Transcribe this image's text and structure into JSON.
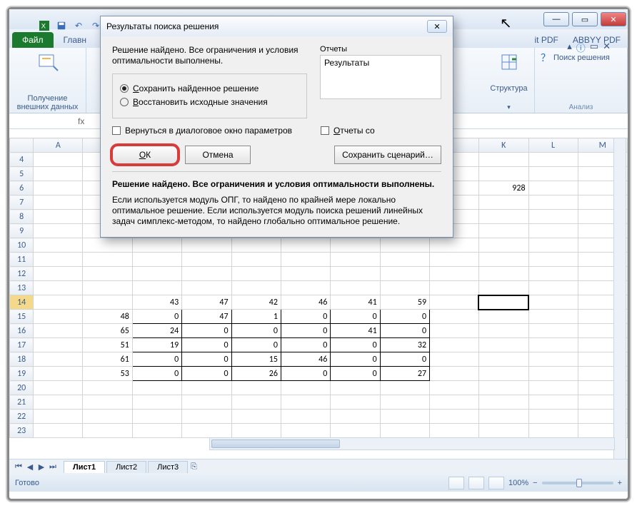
{
  "window": {
    "app_icon": "excel-icon"
  },
  "qat": {
    "save": "save-icon",
    "undo": "undo-icon",
    "redo": "redo-icon"
  },
  "ribbon": {
    "file": "Файл",
    "tabs": [
      "Главн"
    ],
    "right_tabs": [
      "it PDF",
      "ABBYY PDF"
    ],
    "group_getdata_label": "Получение\nвнешних данных",
    "group_struct_label": "Структура",
    "poisk": "Поиск решения",
    "analysis_group": "Анализ"
  },
  "help": {
    "q": "?"
  },
  "columns": [
    "A",
    "",
    "",
    "",
    "",
    "",
    "",
    "",
    "",
    "K",
    "L",
    "M"
  ],
  "first_row": 4,
  "rows": [
    4,
    5,
    6,
    7,
    8,
    9,
    10,
    11,
    12,
    13,
    14,
    15,
    16,
    17,
    18,
    19,
    20,
    21,
    22,
    23
  ],
  "row14_hl": 14,
  "k6": "928",
  "table": {
    "headers": [
      "",
      "43",
      "47",
      "42",
      "46",
      "41",
      "59"
    ],
    "rows": [
      [
        "48",
        "0",
        "47",
        "1",
        "0",
        "0",
        "0"
      ],
      [
        "65",
        "24",
        "0",
        "0",
        "0",
        "41",
        "0"
      ],
      [
        "51",
        "19",
        "0",
        "0",
        "0",
        "0",
        "32"
      ],
      [
        "61",
        "0",
        "0",
        "15",
        "46",
        "0",
        "0"
      ],
      [
        "53",
        "0",
        "0",
        "26",
        "0",
        "0",
        "27"
      ]
    ]
  },
  "sheets": {
    "active": "Лист1",
    "others": [
      "Лист2",
      "Лист3"
    ]
  },
  "status": {
    "ready": "Готово",
    "zoom": "100%"
  },
  "dialog": {
    "title": "Результаты поиска решения",
    "msg": "Решение найдено. Все ограничения и условия оптимальности выполнены.",
    "radio_keep": "Сохранить найденное решение",
    "radio_restore": "Восстановить исходные значения",
    "reports_label": "Отчеты",
    "reports_item": "Результаты",
    "chk_return": "Вернуться в диалоговое окно параметров",
    "chk_reports": "Отчеты со",
    "ok": "ОК",
    "cancel": "Отмена",
    "save_scenario": "Сохранить сценарий…",
    "bold_line": "Решение найдено. Все ограничения и условия оптимальности выполнены.",
    "expl": "Если используется модуль ОПГ, то найдено по крайней мере локально оптимальное решение. Если используется модуль поиска решений линейных задач симплекс-методом, то найдено глобально оптимальное решение."
  }
}
